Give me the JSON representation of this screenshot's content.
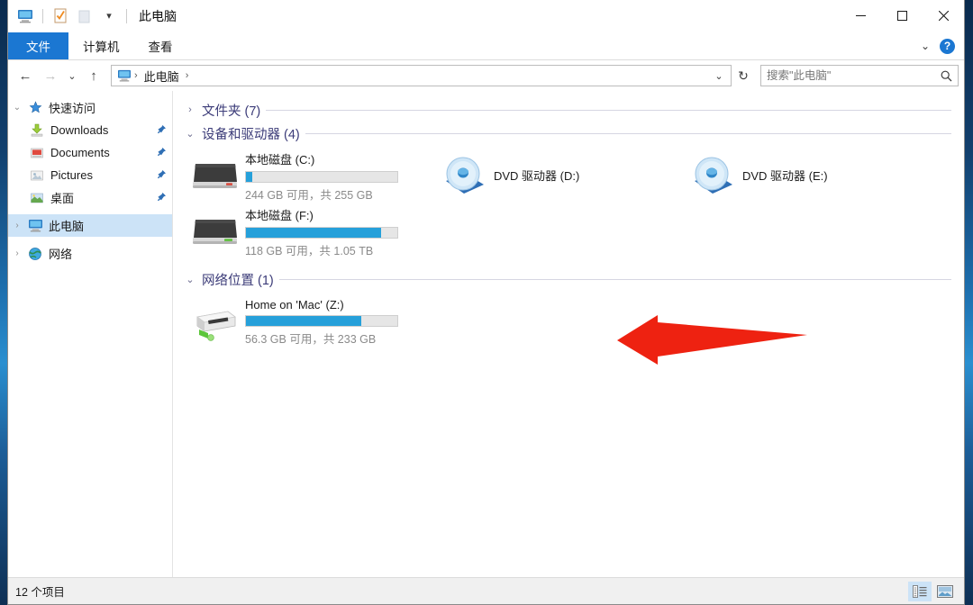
{
  "window": {
    "title": "此电脑",
    "quick_access_icons": [
      "this-pc-icon",
      "properties-icon",
      "new-folder-icon",
      "customize-chevron-icon"
    ],
    "controls": {
      "minimize": "–",
      "maximize": "□",
      "close": "✕"
    }
  },
  "ribbon": {
    "tabs": [
      {
        "label": "文件",
        "active": true
      },
      {
        "label": "计算机",
        "active": false
      },
      {
        "label": "查看",
        "active": false
      }
    ],
    "expand_label": "⌄",
    "help_label": "?"
  },
  "addressbar": {
    "back": "←",
    "forward": "→",
    "recent": "⌄",
    "up": "↑",
    "breadcrumbs": [
      "此电脑"
    ],
    "crumb_sep": "›",
    "dropdown": "⌄",
    "refresh": "↻"
  },
  "search": {
    "placeholder": "搜索\"此电脑\"",
    "icon": "search-icon"
  },
  "sidebar": {
    "items": [
      {
        "label": "快速访问",
        "chevron": "⌄",
        "icon": "star-icon",
        "level": 0,
        "selected": false,
        "pinned": false
      },
      {
        "label": "Downloads",
        "chevron": "",
        "icon": "downloads-icon",
        "level": 1,
        "selected": false,
        "pinned": true
      },
      {
        "label": "Documents",
        "chevron": "",
        "icon": "documents-icon",
        "level": 1,
        "selected": false,
        "pinned": true
      },
      {
        "label": "Pictures",
        "chevron": "",
        "icon": "pictures-icon",
        "level": 1,
        "selected": false,
        "pinned": true
      },
      {
        "label": "桌面",
        "chevron": "",
        "icon": "desktop-icon",
        "level": 1,
        "selected": false,
        "pinned": true
      },
      {
        "label": "此电脑",
        "chevron": "›",
        "icon": "this-pc-icon",
        "level": 0,
        "selected": true,
        "pinned": false
      },
      {
        "label": "网络",
        "chevron": "›",
        "icon": "network-globe-icon",
        "level": 0,
        "selected": false,
        "pinned": false
      }
    ]
  },
  "content": {
    "groups": [
      {
        "title": "文件夹 (7)",
        "chevron": "›",
        "expanded": false,
        "items": []
      },
      {
        "title": "设备和驱动器 (4)",
        "chevron": "⌄",
        "expanded": true,
        "items": [
          {
            "name": "本地磁盘 (C:)",
            "icon": "hard-drive-icon",
            "has_bar": true,
            "used_percent": 4,
            "bar_color": "#26a0da",
            "sub": "244 GB 可用，共 255 GB"
          },
          {
            "name": "DVD 驱动器 (D:)",
            "icon": "dvd-drive-icon",
            "has_bar": false,
            "used_percent": 0,
            "bar_color": "",
            "sub": ""
          },
          {
            "name": "DVD 驱动器 (E:)",
            "icon": "dvd-drive-icon",
            "has_bar": false,
            "used_percent": 0,
            "bar_color": "",
            "sub": ""
          },
          {
            "name": "本地磁盘 (F:)",
            "icon": "hard-drive-icon",
            "has_bar": true,
            "used_percent": 89,
            "bar_color": "#26a0da",
            "sub": "118 GB 可用，共 1.05 TB"
          }
        ]
      },
      {
        "title": "网络位置 (1)",
        "chevron": "⌄",
        "expanded": true,
        "items": [
          {
            "name": "Home on 'Mac' (Z:)",
            "icon": "network-drive-icon",
            "has_bar": true,
            "used_percent": 76,
            "bar_color": "#26a0da",
            "sub": "56.3 GB 可用，共 233 GB"
          }
        ]
      }
    ]
  },
  "annotation": {
    "arrow_color": "#ee2211",
    "direction": "left"
  },
  "statusbar": {
    "item_count": "12 个项目",
    "views": [
      {
        "name": "details-view",
        "active": true
      },
      {
        "name": "large-icons-view",
        "active": false
      }
    ]
  },
  "colors": {
    "accent": "#1b77d2",
    "selection": "#cce3f7",
    "group_title": "#3b3b78",
    "progress": "#26a0da"
  }
}
